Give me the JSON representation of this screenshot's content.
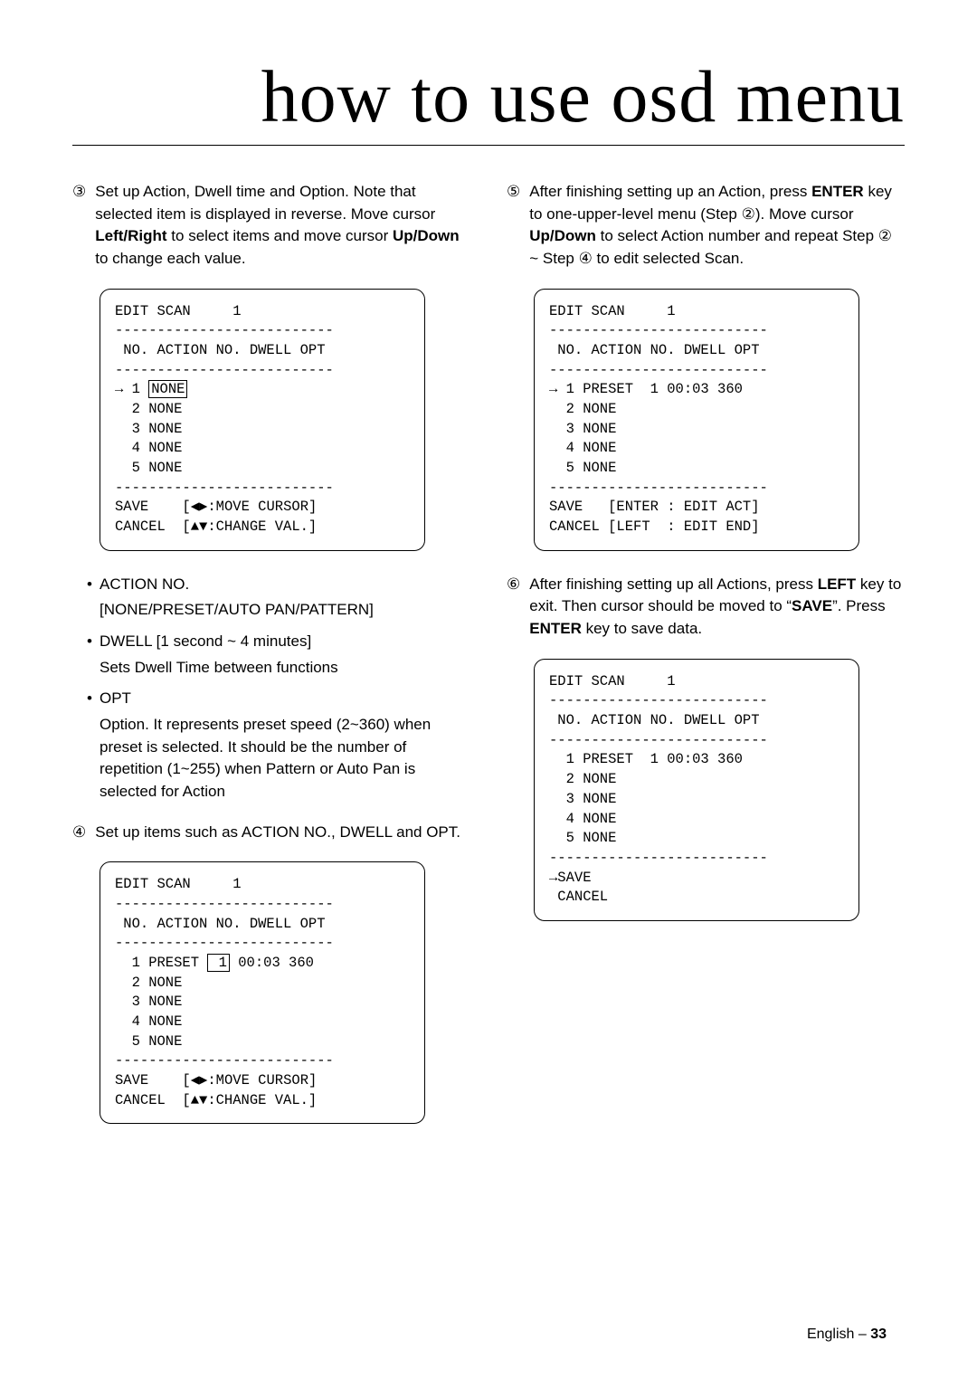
{
  "title": "how to use osd menu",
  "left": {
    "step3": "Set up Action, Dwell time and Option. Note that selected item is displayed in reverse. Move cursor ",
    "step3b": "Left/Right",
    "step3c": " to select items and move cursor ",
    "step3d": "Up/Down",
    "step3e": " to change each value.",
    "osd1": "EDIT SCAN     1\n--------------------------\n NO. ACTION NO. DWELL OPT\n--------------------------\n→ 1 ",
    "osd1_boxed": "NONE",
    "osd1_rest": "\n  2 NONE\n  3 NONE\n  4 NONE\n  5 NONE\n--------------------------\nSAVE    [◀▶:MOVE CURSOR]\nCANCEL  [▲▼:CHANGE VAL.]",
    "bul_action1": "ACTION NO.",
    "bul_action2": "[NONE/PRESET/AUTO PAN/PATTERN]",
    "bul_dwell1": "DWELL    [1 second ~ 4 minutes]",
    "bul_dwell2": "Sets Dwell Time between functions",
    "bul_opt1": "OPT",
    "bul_opt2": "Option. It represents preset speed (2~360) when preset is selected. It should be the number of repetition (1~255) when Pattern or Auto Pan is selected for Action",
    "step4": "Set up items such as ACTION NO., DWELL and OPT.",
    "osd2a": "EDIT SCAN     1\n--------------------------\n NO. ACTION NO. DWELL OPT\n--------------------------\n  1 PRESET ",
    "osd2_boxed": " 1",
    "osd2b": " 00:03 360\n  2 NONE\n  3 NONE\n  4 NONE\n  5 NONE\n--------------------------\nSAVE    [◀▶:MOVE CURSOR]\nCANCEL  [▲▼:CHANGE VAL.]"
  },
  "right": {
    "step5a": "After finishing setting up an Action, press ",
    "step5b": "ENTER",
    "step5c": " key to one-upper-level menu (Step ②). Move cursor ",
    "step5d": "Up/Down",
    "step5e": " to select Action number and repeat Step ② ~ Step ④ to edit selected Scan.",
    "osd3": "EDIT SCAN     1\n--------------------------\n NO. ACTION NO. DWELL OPT\n--------------------------\n→ 1 PRESET  1 00:03 360\n  2 NONE\n  3 NONE\n  4 NONE\n  5 NONE\n--------------------------\nSAVE   [ENTER : EDIT ACT]\nCANCEL [LEFT  : EDIT END]",
    "step6a": "After finishing setting up all Actions, press ",
    "step6b": "LEFT",
    "step6c": " key to exit. Then cursor should be moved to “",
    "step6d": "SAVE",
    "step6e": "”. Press ",
    "step6f": "ENTER",
    "step6g": " key to save data.",
    "osd4": "EDIT SCAN     1\n--------------------------\n NO. ACTION NO. DWELL OPT\n--------------------------\n  1 PRESET  1 00:03 360\n  2 NONE\n  3 NONE\n  4 NONE\n  5 NONE\n--------------------------\n→SAVE\n CANCEL"
  },
  "footer_lang": "English – ",
  "footer_page": "33"
}
